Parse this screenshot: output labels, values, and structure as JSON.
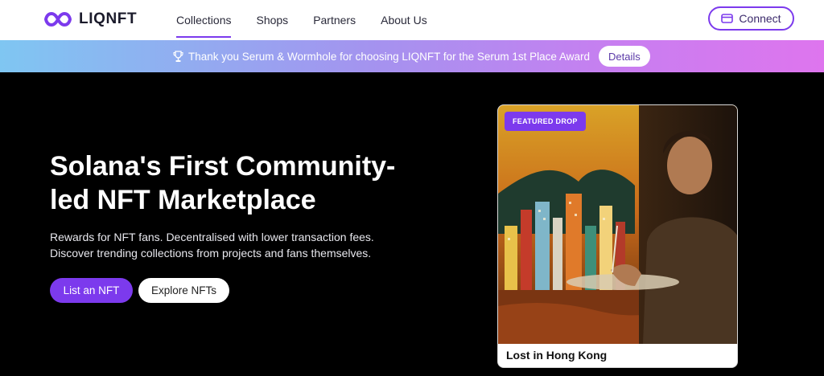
{
  "header": {
    "logo_text": "LIQNFT",
    "nav": [
      {
        "label": "Collections",
        "active": true
      },
      {
        "label": "Shops",
        "active": false
      },
      {
        "label": "Partners",
        "active": false
      },
      {
        "label": "About Us",
        "active": false
      }
    ],
    "connect_label": "Connect"
  },
  "banner": {
    "text": "Thank you Serum & Wormhole for choosing LIQNFT for the Serum 1st Place Award",
    "details_label": "Details",
    "icon": "trophy-icon"
  },
  "hero": {
    "title": "Solana's First Community-led NFT Marketplace",
    "subtitle_line1": "Rewards for NFT fans. Decentralised with lower transaction fees.",
    "subtitle_line2": "Discover trending collections from projects and fans themselves.",
    "primary_label": "List an NFT",
    "secondary_label": "Explore NFTs"
  },
  "featured": {
    "badge": "FEATURED DROP",
    "title": "Lost in Hong Kong"
  },
  "colors": {
    "accent": "#7c3aed",
    "background": "#000000"
  }
}
